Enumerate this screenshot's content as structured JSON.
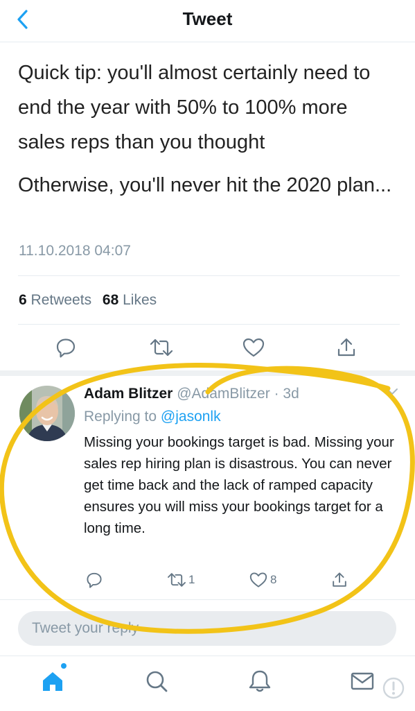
{
  "header": {
    "title": "Tweet"
  },
  "tweet": {
    "paragraphs": [
      "Quick tip: you'll almost certainly need to end the year with 50% to 100% more sales reps than you thought",
      "Otherwise, you'll never hit the 2020 plan..."
    ],
    "timestamp": "11.10.2018 04:07",
    "retweets_count": "6",
    "retweets_label": "Retweets",
    "likes_count": "68",
    "likes_label": "Likes"
  },
  "reply": {
    "name": "Adam Blitzer",
    "handle": "@AdamBlitzer",
    "separator": "·",
    "age": "3d",
    "replying_to_label": "Replying to",
    "replying_to_handle": "@jasonlk",
    "text": "Missing your bookings target is bad. Missing your sales rep hiring plan is disastrous. You can never get time back and the lack of ramped capacity ensures you will miss your bookings target for a long time.",
    "retweet_count": "1",
    "like_count": "8"
  },
  "composer": {
    "placeholder": "Tweet your reply"
  },
  "tabs": [
    "home-icon",
    "search-icon",
    "notifications-icon",
    "messages-icon"
  ],
  "colors": {
    "accent": "#1da1f2",
    "annotation": "#f2c318",
    "muted": "#8899a6"
  }
}
